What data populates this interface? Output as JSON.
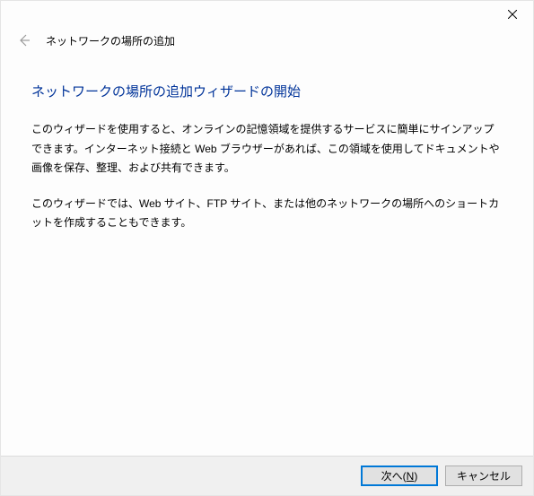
{
  "window": {
    "title": "ネットワークの場所の追加"
  },
  "content": {
    "heading": "ネットワークの場所の追加ウィザードの開始",
    "para1": "このウィザードを使用すると、オンラインの記憶領域を提供するサービスに簡単にサインアップできます。インターネット接続と Web ブラウザーがあれば、この領域を使用してドキュメントや画像を保存、整理、および共有できます。",
    "para2": "このウィザードでは、Web サイト、FTP サイト、または他のネットワークの場所へのショートカットを作成することもできます。"
  },
  "footer": {
    "next_label": "次へ(N)",
    "next_underline_char": "N",
    "cancel_label": "キャンセル"
  }
}
